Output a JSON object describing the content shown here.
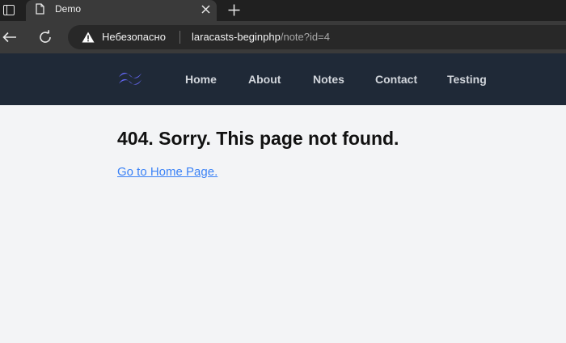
{
  "browser": {
    "tab": {
      "title": "Demo"
    },
    "address_bar": {
      "security_label": "Небезопасно",
      "host": "laracasts-beginphp",
      "path": "/note?id=4"
    }
  },
  "site": {
    "nav": {
      "home": "Home",
      "about": "About",
      "notes": "Notes",
      "contact": "Contact",
      "testing": "Testing"
    },
    "logo_color": "#6366f1",
    "nav_background": "#1f2937"
  },
  "main": {
    "heading": "404. Sorry. This page not found.",
    "home_link": "Go to Home Page."
  },
  "colors": {
    "page_background": "#f3f4f6",
    "link": "#3b82f6",
    "warning": "#ffffff"
  }
}
